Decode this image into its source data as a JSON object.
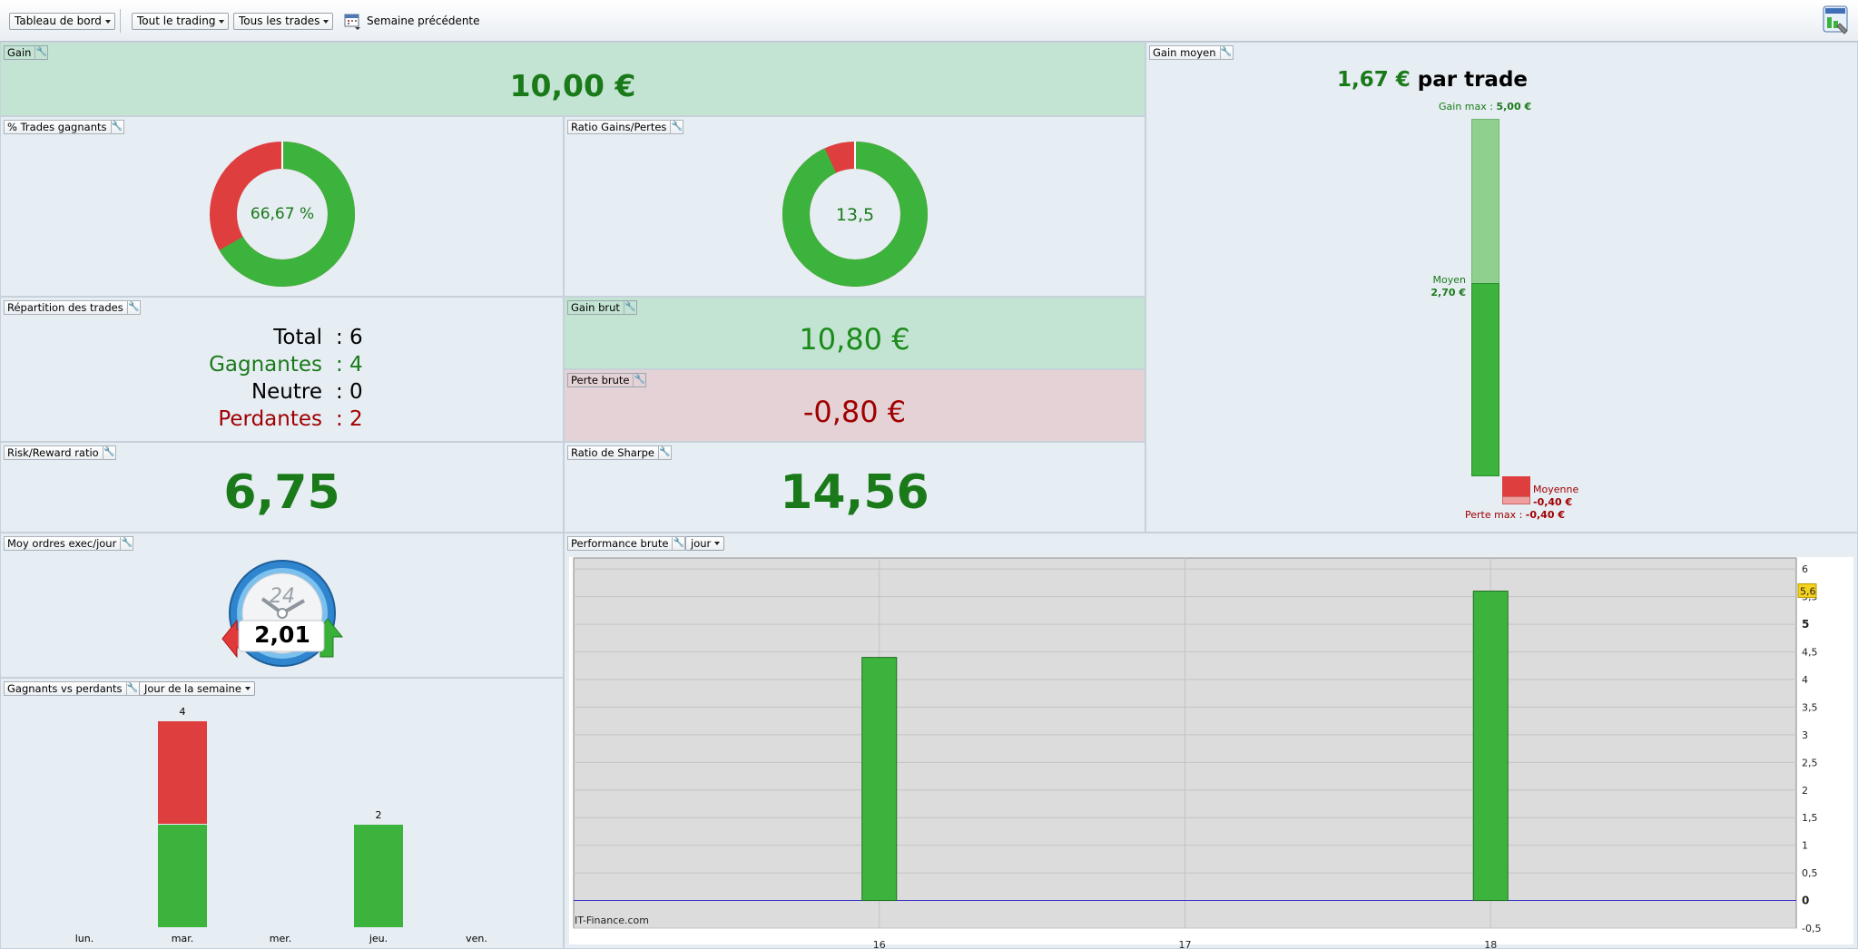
{
  "toolbar": {
    "dashboard_select": "Tableau de bord",
    "trading_select": "Tout le trading",
    "trades_select": "Tous les trades",
    "period_label": "Semaine précédente",
    "calendar_icon": "calendar-icon",
    "app_icon": "dashboard-settings-icon"
  },
  "gain": {
    "title": "Gain",
    "value": "10,00 €"
  },
  "win_pct": {
    "title": "% Trades gagnants",
    "value": "66,67 %",
    "fraction": 0.6667
  },
  "ratio_gp": {
    "title": "Ratio Gains/Pertes",
    "value": "13,5",
    "fraction": 0.931
  },
  "repartition": {
    "title": "Répartition des trades",
    "rows": [
      {
        "label": "Total",
        "value": ": 6"
      },
      {
        "label": "Gagnantes",
        "value": ": 4"
      },
      {
        "label": "Neutre",
        "value": ": 0"
      },
      {
        "label": "Perdantes",
        "value": ": 2"
      }
    ]
  },
  "gain_brut": {
    "title": "Gain brut",
    "value": "10,80 €"
  },
  "perte_brute": {
    "title": "Perte brute",
    "value": "-0,80 €"
  },
  "risk_reward": {
    "title": "Risk/Reward ratio",
    "value": "6,75"
  },
  "sharpe": {
    "title": "Ratio de Sharpe",
    "value": "14,56"
  },
  "gain_moyen": {
    "title": "Gain moyen",
    "value": "1,67 €",
    "suffix": "par trade",
    "gain_max_label": "Gain max  :",
    "gain_max_value": "5,00 €",
    "moyen_label": "Moyen",
    "moyen_value": "2,70 €",
    "moyenne_label": "Moyenne",
    "moyenne_value": "-0,40 €",
    "perte_max_label": "Perte max  :",
    "perte_max_value": "-0,40 €",
    "gain_max_num": 5.0,
    "moyen_num": 2.7,
    "perte_num": -0.4
  },
  "ordres": {
    "title": "Moy ordres exec/jour",
    "value": "2,01",
    "clock_label": "24"
  },
  "gagnants_perdants": {
    "title": "Gagnants vs perdants",
    "select": "Jour de la semaine",
    "chart_data": {
      "type": "bar",
      "categories": [
        "lun.",
        "mar.",
        "mer.",
        "jeu.",
        "ven."
      ],
      "series": [
        {
          "values": [
            0,
            2,
            0,
            2,
            0
          ],
          "color": "#3cb33c"
        },
        {
          "values": [
            0,
            2,
            0,
            0,
            0
          ],
          "color": "#de3e3e"
        }
      ],
      "totals": [
        null,
        "4",
        null,
        "2",
        null
      ],
      "ylim": [
        0,
        4
      ]
    }
  },
  "performance": {
    "title": "Performance brute",
    "select": "jour",
    "watermark": "IT-Finance.com",
    "chart_data": {
      "type": "bar",
      "x_ticks": [
        "16",
        "17",
        "18"
      ],
      "bars": [
        {
          "x": 16,
          "y": 4.4
        },
        {
          "x": 18,
          "y": 5.6
        }
      ],
      "y_ticks": [
        "6",
        "5,5",
        "5",
        "4,5",
        "4",
        "3,5",
        "3",
        "2,5",
        "2",
        "1,5",
        "1",
        "0,5",
        "0",
        "-0,5"
      ],
      "ylim": [
        -0.5,
        6.2
      ],
      "xlim": [
        15,
        19
      ],
      "highlight_label": "5,6",
      "highlight_value": 5.6
    }
  },
  "colors": {
    "win": "#3cb33c",
    "loss": "#de3e3e",
    "text_green": "#1a7a1a",
    "text_red": "#a00000"
  }
}
